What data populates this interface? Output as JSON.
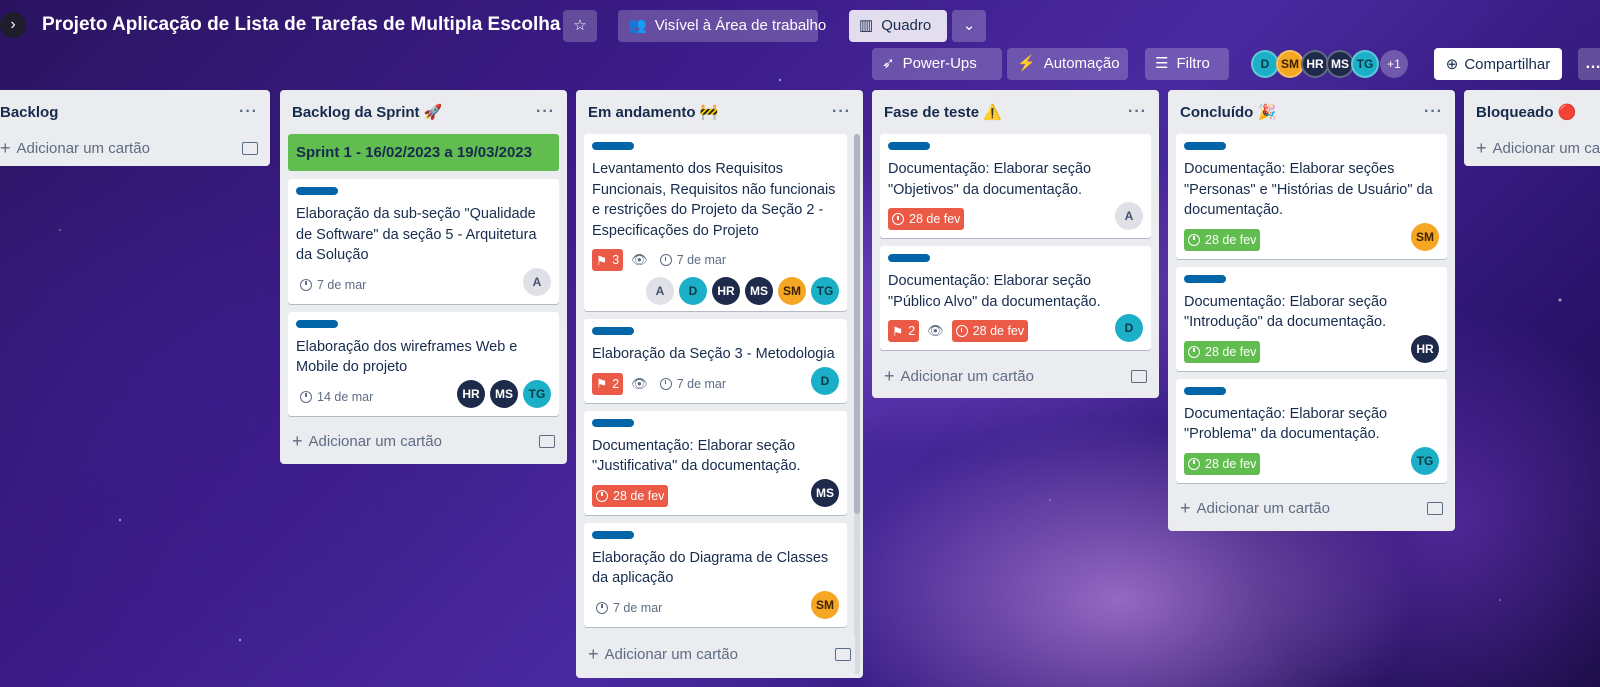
{
  "header": {
    "title": "Projeto Aplicação de Lista de Tarefas de Multipla Escolha",
    "visibility": "Visível à Área de trabalho",
    "view": "Quadro",
    "power_ups": "Power-Ups",
    "automation": "Automação",
    "filter": "Filtro",
    "members": [
      "D",
      "SM",
      "HR",
      "MS",
      "TG"
    ],
    "members_more": "+1",
    "share": "Compartilhar"
  },
  "add_card_label": "Adicionar um cartão",
  "lists": {
    "backlog": {
      "title": "Backlog"
    },
    "sprint": {
      "title": "Backlog da Sprint 🚀",
      "sprint_card": "Sprint 1 - 16/02/2023 a 19/03/2023",
      "cards": [
        {
          "title": "Elaboração da sub-seção \"Qualidade de Software\" da seção 5 - Arquitetura da Solução",
          "date": "7 de mar",
          "members": [
            "A"
          ]
        },
        {
          "title": "Elaboração dos wireframes Web e Mobile do projeto",
          "date": "14 de mar",
          "members": [
            "HR",
            "MS",
            "TG"
          ]
        }
      ]
    },
    "progress": {
      "title": "Em andamento 🚧",
      "cards": [
        {
          "title": "Levantamento dos Requisitos Funcionais, Requisitos não funcionais e restrições do Projeto da Seção 2 - Especificações do Projeto",
          "priority": "3",
          "date": "7 de mar",
          "members": [
            "A",
            "D",
            "HR",
            "MS",
            "SM",
            "TG"
          ]
        },
        {
          "title": "Elaboração da Seção 3 - Metodologia",
          "priority": "2",
          "date": "7 de mar",
          "members": [
            "D"
          ]
        },
        {
          "title": "Documentação: Elaborar seção \"Justificativa\" da documentação.",
          "date": "28 de fev",
          "members": [
            "MS"
          ]
        },
        {
          "title": "Elaboração do Diagrama de Classes da aplicação",
          "date": "7 de mar",
          "members": [
            "SM"
          ]
        }
      ]
    },
    "testing": {
      "title": "Fase de teste ⚠️",
      "cards": [
        {
          "title": "Documentação: Elaborar seção \"Objetivos\" da documentação.",
          "date": "28 de fev",
          "members": [
            "A"
          ]
        },
        {
          "title": "Documentação: Elaborar seção \"Público Alvo\" da documentação.",
          "priority": "2",
          "date": "28 de fev",
          "members": [
            "D"
          ]
        }
      ]
    },
    "done": {
      "title": "Concluído 🎉",
      "cards": [
        {
          "title": "Documentação: Elaborar seções \"Personas\" e \"Histórias de Usuário\" da documentação.",
          "date": "28 de fev",
          "members": [
            "SM"
          ]
        },
        {
          "title": "Documentação: Elaborar seção \"Introdução\" da documentação.",
          "date": "28 de fev",
          "members": [
            "HR"
          ]
        },
        {
          "title": "Documentação: Elaborar seção \"Problema\" da documentação.",
          "date": "28 de fev",
          "members": [
            "TG"
          ]
        }
      ]
    },
    "blocked": {
      "title": "Bloqueado 🔴"
    }
  },
  "colors": {
    "label_blue": "#0265a8",
    "due_overdue": "#eb5a46",
    "due_complete": "#61bd4f",
    "sprint_green": "#61bd4f"
  }
}
